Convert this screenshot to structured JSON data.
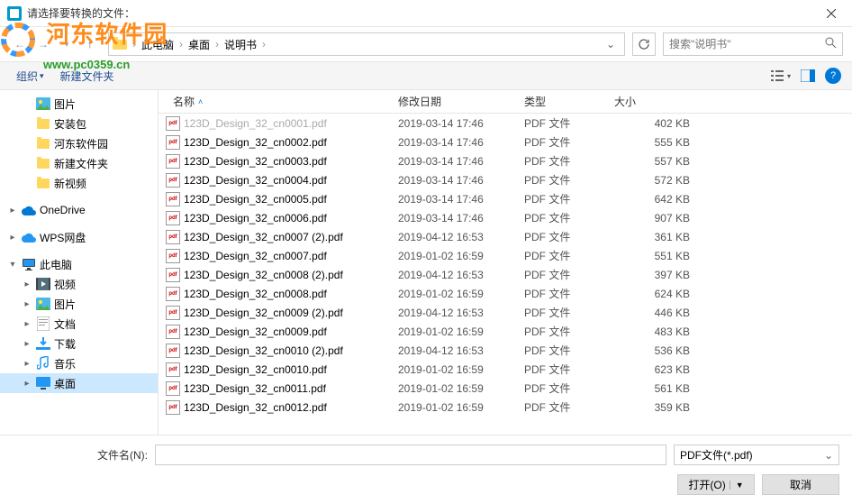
{
  "title": "请选择要转换的文件：",
  "breadcrumb": {
    "items": [
      "此电脑",
      "桌面",
      "说明书"
    ]
  },
  "search": {
    "placeholder": "搜索\"说明书\""
  },
  "toolbar": {
    "organize": "组织",
    "newfolder": "新建文件夹"
  },
  "sidebar": {
    "items": [
      {
        "label": "图片",
        "icon": "pictures",
        "indent": 1,
        "chev": ""
      },
      {
        "label": "安装包",
        "icon": "folder",
        "indent": 1,
        "chev": ""
      },
      {
        "label": "河东软件园",
        "icon": "folder",
        "indent": 1,
        "chev": ""
      },
      {
        "label": "新建文件夹",
        "icon": "folder",
        "indent": 1,
        "chev": ""
      },
      {
        "label": "新视频",
        "icon": "folder",
        "indent": 1,
        "chev": ""
      },
      {
        "label": "",
        "icon": "",
        "indent": 0,
        "chev": ""
      },
      {
        "label": "OneDrive",
        "icon": "onedrive",
        "indent": 0,
        "chev": "▸"
      },
      {
        "label": "",
        "icon": "",
        "indent": 0,
        "chev": ""
      },
      {
        "label": "WPS网盘",
        "icon": "wps",
        "indent": 0,
        "chev": "▸"
      },
      {
        "label": "",
        "icon": "",
        "indent": 0,
        "chev": ""
      },
      {
        "label": "此电脑",
        "icon": "pc",
        "indent": 0,
        "chev": "▾"
      },
      {
        "label": "视频",
        "icon": "video",
        "indent": 1,
        "chev": "▸"
      },
      {
        "label": "图片",
        "icon": "pictures",
        "indent": 1,
        "chev": "▸"
      },
      {
        "label": "文档",
        "icon": "docs",
        "indent": 1,
        "chev": "▸"
      },
      {
        "label": "下载",
        "icon": "download",
        "indent": 1,
        "chev": "▸"
      },
      {
        "label": "音乐",
        "icon": "music",
        "indent": 1,
        "chev": "▸"
      },
      {
        "label": "桌面",
        "icon": "desktop",
        "indent": 1,
        "chev": "▸",
        "selected": true
      }
    ]
  },
  "headers": {
    "name": "名称",
    "date": "修改日期",
    "type": "类型",
    "size": "大小"
  },
  "files": [
    {
      "name": "123D_Design_32_cn0001.pdf",
      "date": "2019-03-14 17:46",
      "type": "PDF 文件",
      "size": "402 KB",
      "dim": true
    },
    {
      "name": "123D_Design_32_cn0002.pdf",
      "date": "2019-03-14 17:46",
      "type": "PDF 文件",
      "size": "555 KB"
    },
    {
      "name": "123D_Design_32_cn0003.pdf",
      "date": "2019-03-14 17:46",
      "type": "PDF 文件",
      "size": "557 KB"
    },
    {
      "name": "123D_Design_32_cn0004.pdf",
      "date": "2019-03-14 17:46",
      "type": "PDF 文件",
      "size": "572 KB"
    },
    {
      "name": "123D_Design_32_cn0005.pdf",
      "date": "2019-03-14 17:46",
      "type": "PDF 文件",
      "size": "642 KB"
    },
    {
      "name": "123D_Design_32_cn0006.pdf",
      "date": "2019-03-14 17:46",
      "type": "PDF 文件",
      "size": "907 KB"
    },
    {
      "name": "123D_Design_32_cn0007 (2).pdf",
      "date": "2019-04-12 16:53",
      "type": "PDF 文件",
      "size": "361 KB"
    },
    {
      "name": "123D_Design_32_cn0007.pdf",
      "date": "2019-01-02 16:59",
      "type": "PDF 文件",
      "size": "551 KB"
    },
    {
      "name": "123D_Design_32_cn0008 (2).pdf",
      "date": "2019-04-12 16:53",
      "type": "PDF 文件",
      "size": "397 KB"
    },
    {
      "name": "123D_Design_32_cn0008.pdf",
      "date": "2019-01-02 16:59",
      "type": "PDF 文件",
      "size": "624 KB"
    },
    {
      "name": "123D_Design_32_cn0009 (2).pdf",
      "date": "2019-04-12 16:53",
      "type": "PDF 文件",
      "size": "446 KB"
    },
    {
      "name": "123D_Design_32_cn0009.pdf",
      "date": "2019-01-02 16:59",
      "type": "PDF 文件",
      "size": "483 KB"
    },
    {
      "name": "123D_Design_32_cn0010 (2).pdf",
      "date": "2019-04-12 16:53",
      "type": "PDF 文件",
      "size": "536 KB"
    },
    {
      "name": "123D_Design_32_cn0010.pdf",
      "date": "2019-01-02 16:59",
      "type": "PDF 文件",
      "size": "623 KB"
    },
    {
      "name": "123D_Design_32_cn0011.pdf",
      "date": "2019-01-02 16:59",
      "type": "PDF 文件",
      "size": "561 KB"
    },
    {
      "name": "123D_Design_32_cn0012.pdf",
      "date": "2019-01-02 16:59",
      "type": "PDF 文件",
      "size": "359 KB"
    }
  ],
  "footer": {
    "filename_label": "文件名(N):",
    "filter": "PDF文件(*.pdf)",
    "open": "打开(O)",
    "cancel": "取消"
  },
  "watermark": {
    "text": "河东软件园",
    "url": "www.pc0359.cn"
  }
}
